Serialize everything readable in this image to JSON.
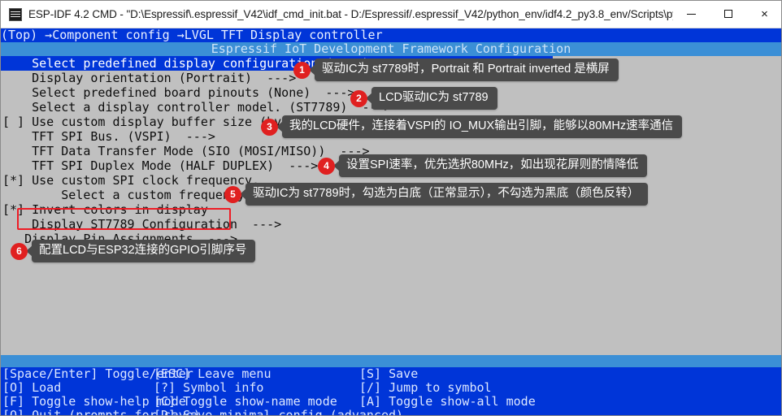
{
  "window": {
    "title": "ESP-IDF 4.2 CMD - \"D:\\Espressif\\.espressif_V42\\idf_cmd_init.bat - D:/Espressif/.espressif_V42/python_env/idf4.2_py3.8_env/Scripts\\pyth...",
    "minimize_label": "—",
    "maximize_label": "",
    "close_label": "×",
    "icon": "console-icon"
  },
  "console": {
    "breadcrumb": "(Top) →Component config →LVGL TFT Display controller",
    "banner": "Espressif IoT Development Framework Configuration",
    "menu_rows": [
      {
        "text": "    Select predefined display configuration (None)  --->",
        "selected": true
      },
      {
        "text": "    Display orientation (Portrait)  --->",
        "selected": false
      },
      {
        "text": "    Select predefined board pinouts (None)  --->",
        "selected": false
      },
      {
        "text": "    Select a display controller model. (ST7789)  --->",
        "selected": false
      },
      {
        "text": "[ ] Use custom display buffer size (bytes)",
        "selected": false
      },
      {
        "text": "    TFT SPI Bus. (VSPI)  --->",
        "selected": false
      },
      {
        "text": "    TFT Data Transfer Mode (SIO (MOSI/MISO))  --->",
        "selected": false
      },
      {
        "text": "    TFT SPI Duplex Mode (HALF DUPLEX)  --->",
        "selected": false
      },
      {
        "text": "[*] Use custom SPI clock frequency.",
        "selected": false
      },
      {
        "text": "        Select a custom frequency. (40 MHz)  --->",
        "selected": false
      },
      {
        "text": "[*] Invert colors in display",
        "selected": false
      },
      {
        "text": "    Display ST7789 Configuration  --->",
        "selected": false
      },
      {
        "text": "   Display Pin Assignments  --->",
        "selected": false
      }
    ],
    "help_rows": [
      {
        "a": "[Space/Enter] Toggle/enter",
        "b": "[ESC] Leave menu",
        "c": "[S] Save"
      },
      {
        "a": "[O] Load",
        "b": "[?] Symbol info",
        "c": "[/] Jump to symbol"
      },
      {
        "a": "[F] Toggle show-help mode",
        "b": "[C] Toggle show-name mode",
        "c": "[A] Toggle show-all mode"
      },
      {
        "a": "[Q] Quit (prompts for save)",
        "b": "[D] Save minimal config (advanced)",
        "c": ""
      }
    ]
  },
  "annotations": [
    {
      "num": "1",
      "text": "驱动IC为 st7789时，Portrait 和 Portrait inverted 是横屏"
    },
    {
      "num": "2",
      "text": "LCD驱动IC为 st7789"
    },
    {
      "num": "3",
      "text": "我的LCD硬件，连接着VSPI的 IO_MUX输出引脚，能够以80MHz速率通信"
    },
    {
      "num": "4",
      "text": "设置SPI速率，优先选択80MHz，如出现花屏则酌情降低"
    },
    {
      "num": "5",
      "text": "驱动IC为 st7789时，勾选为白底（正常显示），不勾选为黑底（颜色反转）"
    },
    {
      "num": "6",
      "text": "配置LCD与ESP32连接的GPIO引脚序号"
    }
  ],
  "colors": {
    "console_bg": "#c0c0c0",
    "blue": "#0035d8",
    "light_blue": "#3b8fd6",
    "badge_red": "#e02020",
    "highlight_box_red": "#ee1c25",
    "bubble_gray": "#4a4a4a"
  }
}
